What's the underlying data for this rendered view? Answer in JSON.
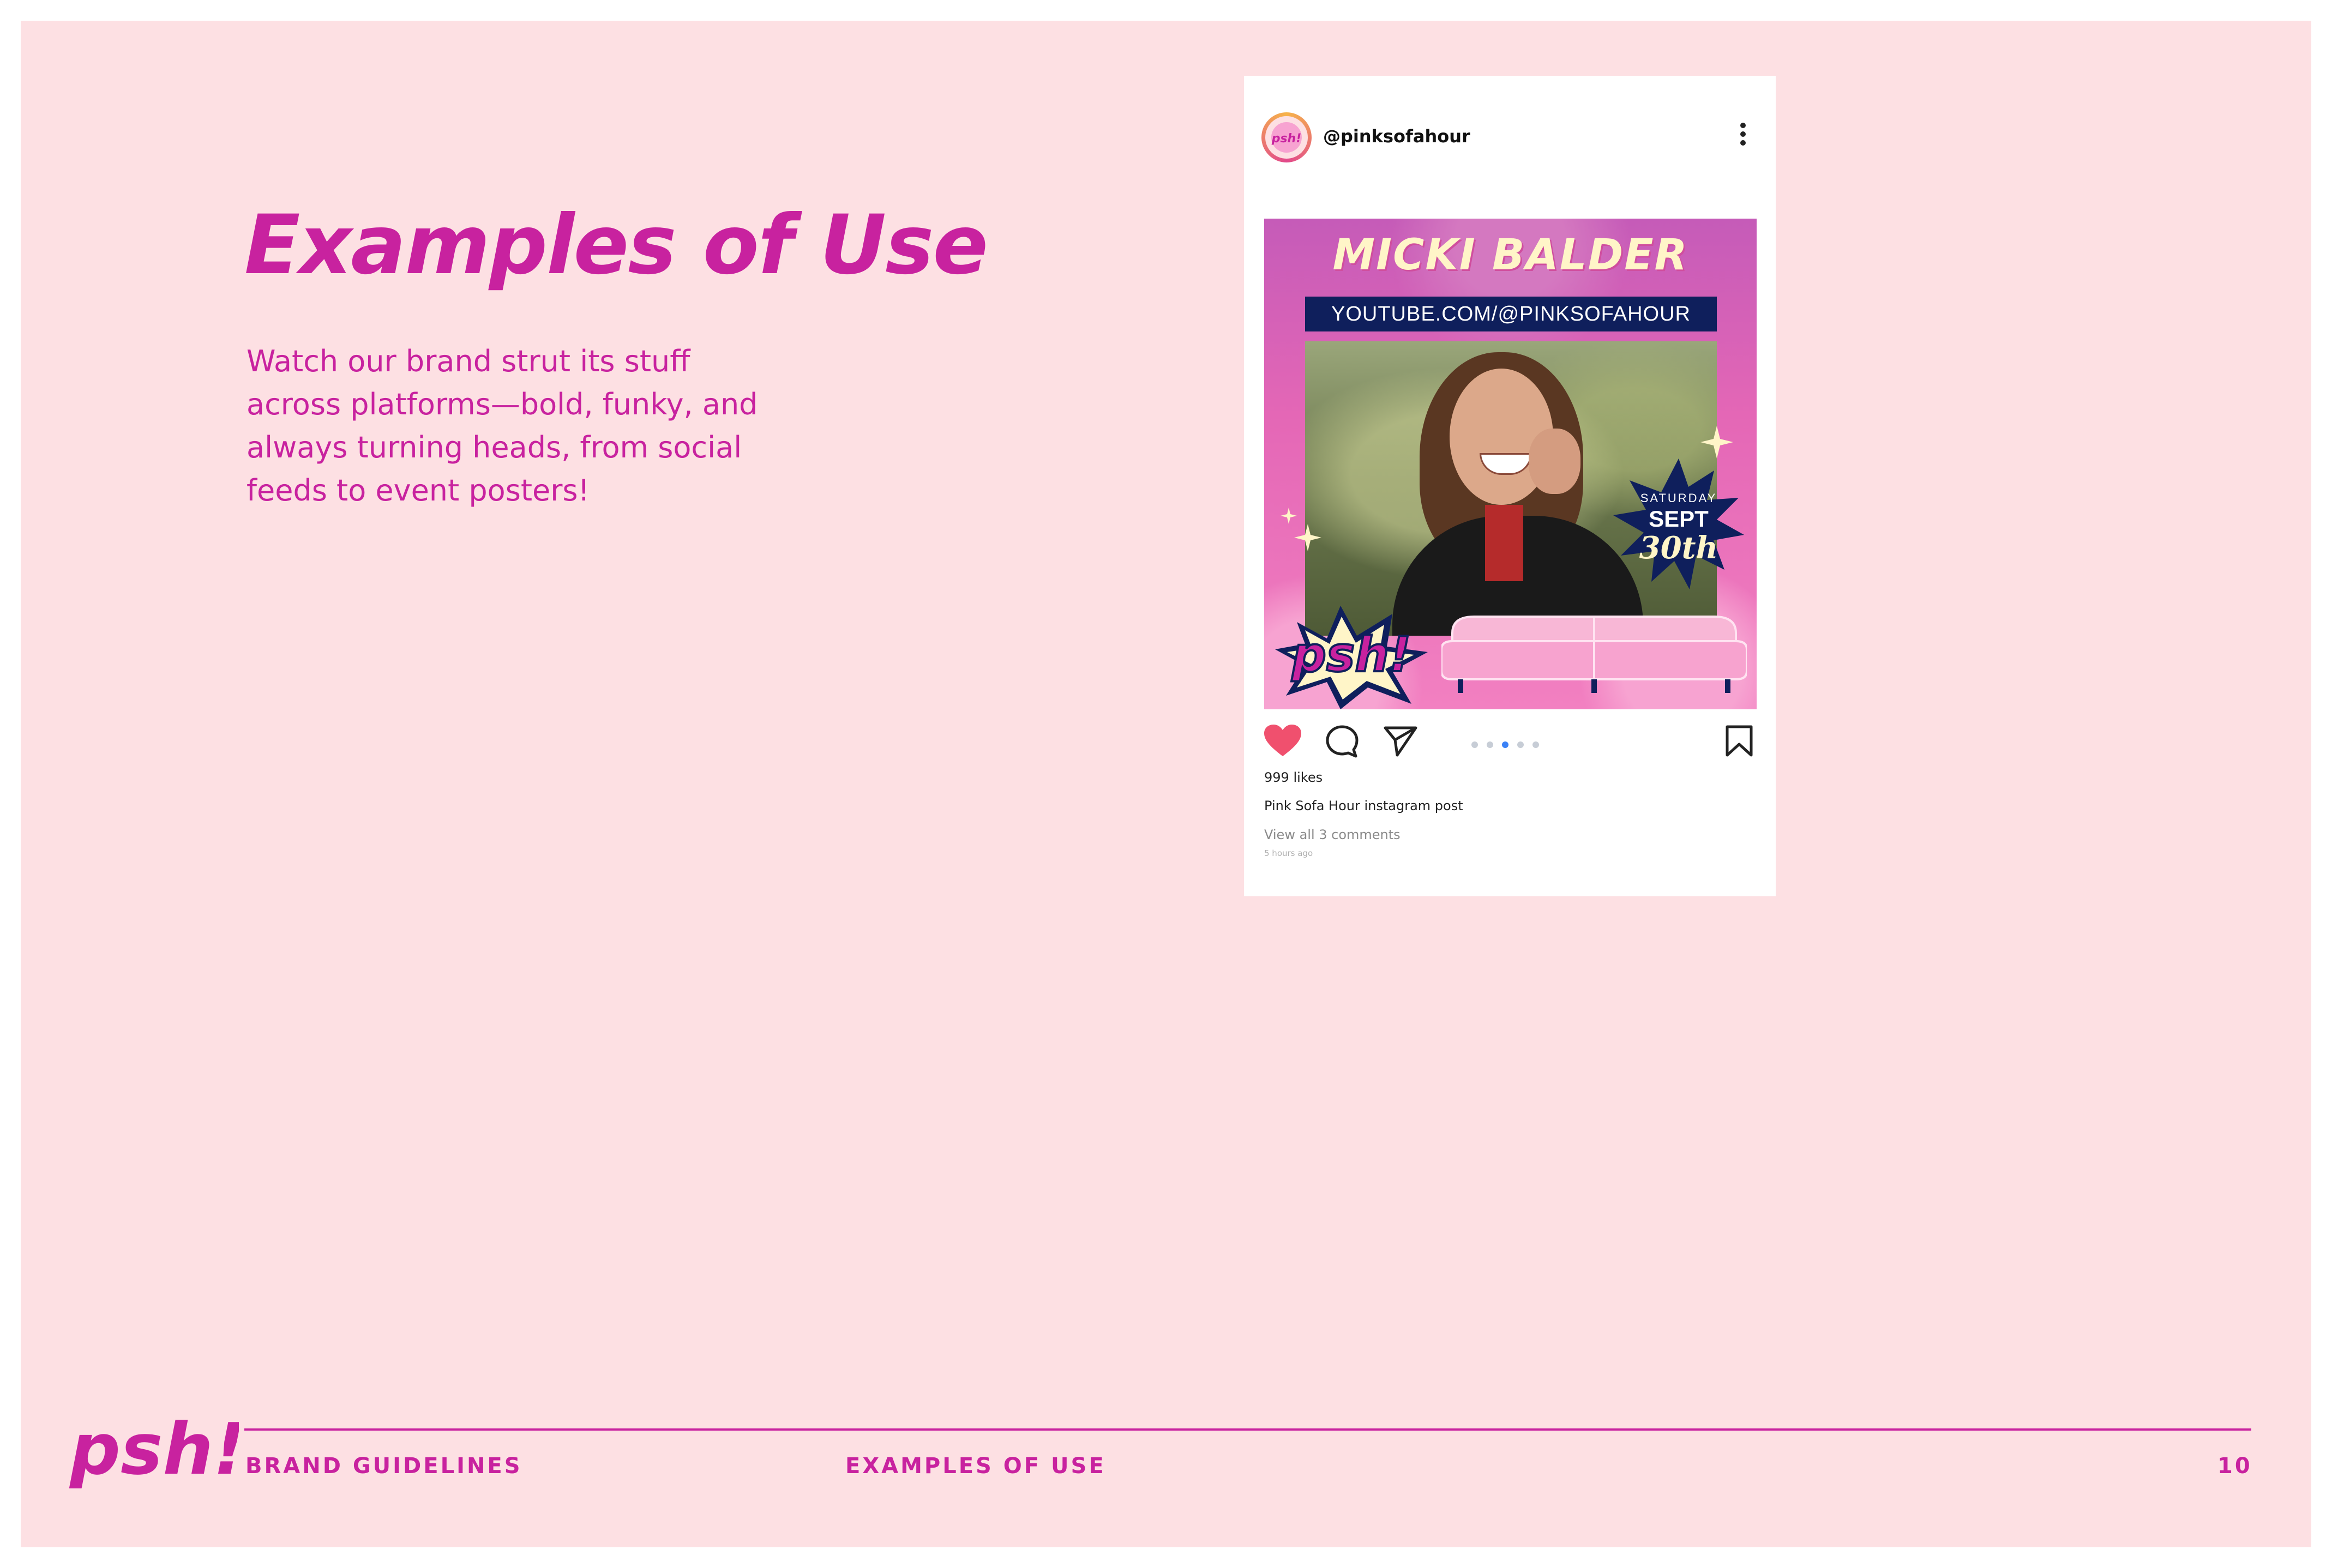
{
  "page": {
    "title": "Examples of Use",
    "intro_lines": [
      "Watch our brand strut its stuff",
      "across platforms—bold, funky, and",
      "always turning heads, from social",
      "feeds to event posters!"
    ]
  },
  "instagram_post": {
    "handle": "@pinksofahour",
    "graphic": {
      "name": "MICKI BALDER",
      "url": "YOUTUBE.COM/@PINKSOFAHOUR",
      "date_day": "SATURDAY",
      "date_month": "SEPT",
      "date_num": "30th",
      "logo_text": "psh!"
    },
    "likes": "999 likes",
    "caption": "Pink Sofa Hour instagram post",
    "comments_link": "View all 3 comments",
    "time_ago": "5 hours ago",
    "carousel": {
      "count": 5,
      "active": 3
    }
  },
  "footer": {
    "logo_text": "psh!",
    "left": "BRAND GUIDELINES",
    "center": "EXAMPLES OF USE",
    "page_number": "10"
  },
  "icons": {
    "like": "heart-icon",
    "comment": "comment-icon",
    "share": "share-icon",
    "save": "bookmark-icon",
    "more": "more-options-icon"
  },
  "colors": {
    "background": "#fde0e3",
    "brand_magenta": "#c8229f",
    "navy": "#0f1f5c",
    "cream": "#fff5c8",
    "heart": "#f0506e"
  }
}
